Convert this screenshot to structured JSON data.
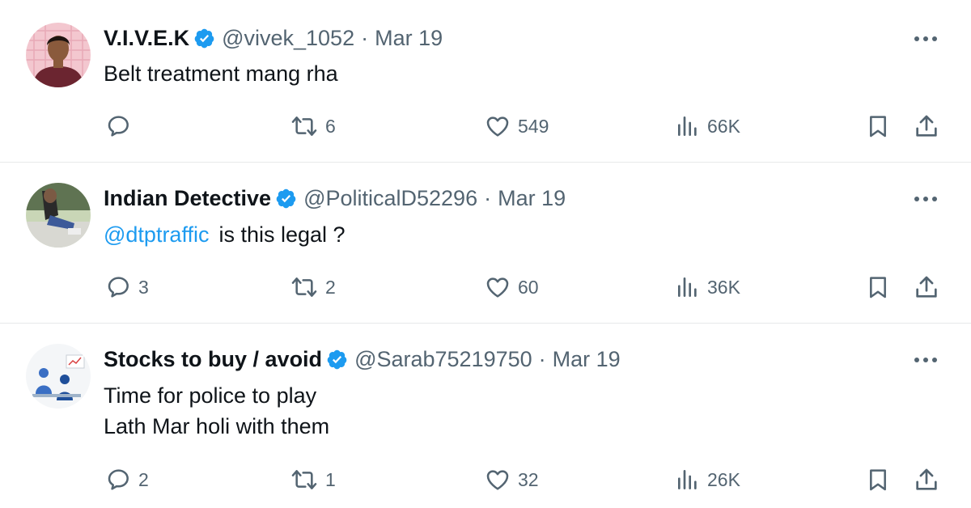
{
  "tweets": [
    {
      "author": {
        "name": "V.I.V.E.K",
        "handle": "@vivek_1052",
        "verified": true
      },
      "date": "Mar 19",
      "text_lines": [
        "Belt treatment mang rha"
      ],
      "mention": "",
      "text": "",
      "stats": {
        "replies": "",
        "retweets": "6",
        "likes": "549",
        "views": "66K"
      }
    },
    {
      "author": {
        "name": "Indian Detective",
        "handle": "@PoliticalD52296",
        "verified": true
      },
      "date": "Mar 19",
      "text_lines": [],
      "mention": "@dtptraffic",
      "text": "is this legal ?",
      "stats": {
        "replies": "3",
        "retweets": "2",
        "likes": "60",
        "views": "36K"
      }
    },
    {
      "author": {
        "name": "Stocks to buy / avoid",
        "handle": "@Sarab75219750",
        "verified": true
      },
      "date": "Mar 19",
      "text_lines": [
        "Time for police to play",
        "Lath Mar holi with them"
      ],
      "mention": "",
      "text": "",
      "stats": {
        "replies": "2",
        "retweets": "1",
        "likes": "32",
        "views": "26K"
      }
    }
  ],
  "separator": "·",
  "colors": {
    "text": "#0f1419",
    "secondary": "#536471",
    "link": "#1d9bf0",
    "verified": "#1d9bf0",
    "divider": "#e7e9ea"
  },
  "icons": {
    "reply": "speech-bubble",
    "retweet": "retweet-arrows",
    "like": "heart",
    "views": "bar-chart",
    "bookmark": "bookmark",
    "share": "upload-arrow",
    "verified": "verified-badge",
    "more": "three-dots"
  }
}
